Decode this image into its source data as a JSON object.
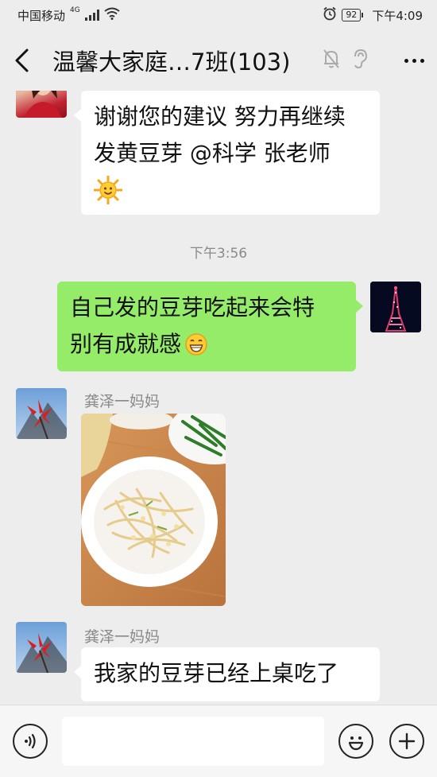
{
  "status_bar": {
    "carrier": "中国移动",
    "network": "4G",
    "battery": "92",
    "time": "下午4:09"
  },
  "nav": {
    "title": "温馨大家庭…7班(103)",
    "icons": [
      "back-arrow",
      "mute-bell",
      "ear",
      "more-dots"
    ]
  },
  "messages": [
    {
      "side": "left",
      "text_line1": "谢谢您的建议 努力再继续",
      "text_line2": "发黄豆芽 @科学 张老师",
      "emoji": "sun"
    },
    {
      "timestamp": "下午3:56"
    },
    {
      "side": "right",
      "text_line1": "自己发的豆芽吃起来会特",
      "text_line2": "别有成就感",
      "emoji": "grin"
    },
    {
      "side": "left",
      "sender": "龚泽一妈妈",
      "type": "image",
      "image_desc": "plate of stir-fried bean sprouts"
    },
    {
      "side": "left",
      "sender": "龚泽一妈妈",
      "text_line1": "我家的豆芽已经上桌吃了"
    }
  ],
  "input_bar": {
    "icons": [
      "voice-icon",
      "emoji-icon",
      "plus-icon"
    ]
  },
  "colors": {
    "background": "#ededed",
    "bubble_self": "#95ec69",
    "bubble_other": "#ffffff"
  }
}
